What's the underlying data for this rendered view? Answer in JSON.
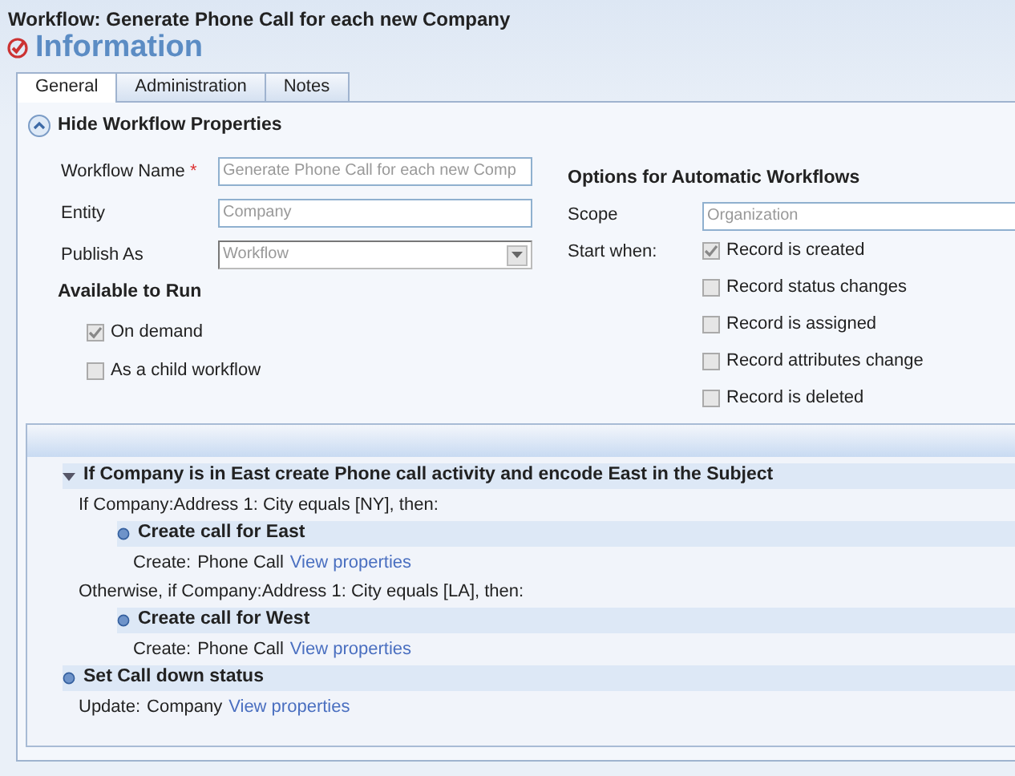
{
  "window": {
    "title": "Workflow: Generate Phone Call for each new Company"
  },
  "heading": "Information",
  "tabs": [
    {
      "label": "General",
      "selected": true
    },
    {
      "label": "Administration",
      "selected": false
    },
    {
      "label": "Notes",
      "selected": false
    }
  ],
  "properties_toggle": {
    "label": "Hide Workflow Properties",
    "expanded": true
  },
  "fields": [
    {
      "kind": "text",
      "label": "Workflow Name",
      "marker": "*",
      "value": "Generate Phone Call for each new Comp"
    },
    {
      "kind": "text",
      "label": "Entity",
      "value": "Company"
    },
    {
      "kind": "select",
      "label": "Publish As",
      "value": "Workflow"
    }
  ],
  "available_to_run": {
    "title": "Available to Run",
    "options": [
      {
        "label": "On demand",
        "checked": true
      },
      {
        "label": "As a child workflow",
        "checked": false
      }
    ]
  },
  "automatic": {
    "title": "Options for Automatic Workflows",
    "scope_label": "Scope",
    "scope_value": "Organization",
    "start_label": "Start when:",
    "options": [
      {
        "label": "Record is created",
        "checked": true
      },
      {
        "label": "Record status changes",
        "checked": false
      },
      {
        "label": "Record is assigned",
        "checked": false
      },
      {
        "label": "Record attributes change",
        "checked": false
      },
      {
        "label": "Record is deleted",
        "checked": false
      }
    ]
  },
  "steps": [
    {
      "kind": "stage",
      "title": "If Company is in East create Phone call activity and encode East in the Subject",
      "expanded": true,
      "children": [
        {
          "kind": "condition",
          "text": "If Company:Address 1: City equals [NY], then:",
          "children": [
            {
              "kind": "step",
              "title": "Create call for East",
              "action": "Create:",
              "target": "Phone Call",
              "link": "View properties"
            }
          ]
        },
        {
          "kind": "condition",
          "text": "Otherwise, if Company:Address 1: City equals [LA], then:",
          "children": [
            {
              "kind": "step",
              "title": "Create call for West",
              "action": "Create:",
              "target": "Phone Call",
              "link": "View properties"
            }
          ]
        }
      ]
    },
    {
      "kind": "step",
      "title": "Set Call down status",
      "action": "Update:",
      "target": "Company",
      "link": "View properties"
    }
  ]
}
